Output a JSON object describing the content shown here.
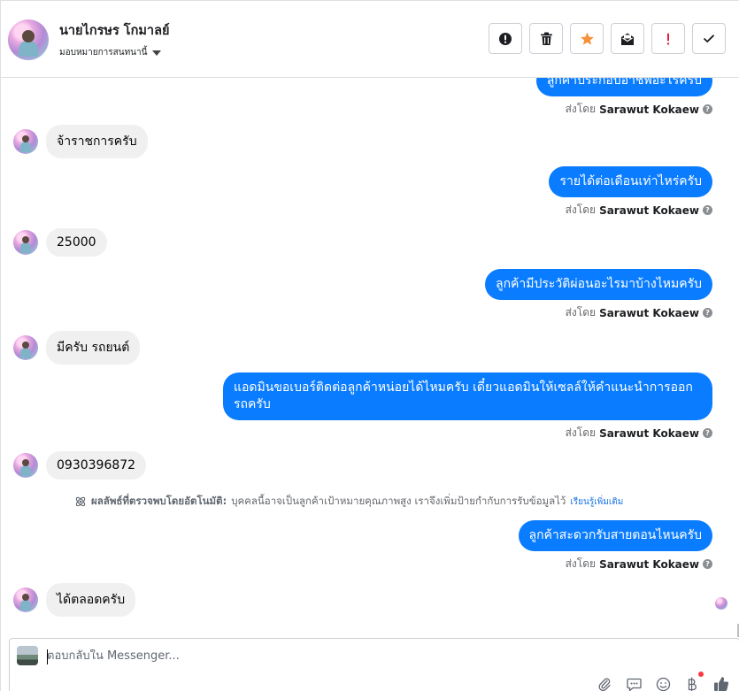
{
  "header": {
    "contact_name": "นายไกรษร โกมาลย์",
    "assign_label": "มอบหมายการสนทนานี้"
  },
  "toolbar": [
    {
      "name": "spam-button",
      "icon": "alert-circle-icon",
      "color": "#1c1e21"
    },
    {
      "name": "delete-button",
      "icon": "trash-icon",
      "color": "#1c1e21"
    },
    {
      "name": "star-button",
      "icon": "star-icon",
      "color": "#f7923b"
    },
    {
      "name": "mark-unread-button",
      "icon": "envelope-icon",
      "color": "#1c1e21"
    },
    {
      "name": "follow-up-button",
      "icon": "exclamation-icon",
      "color": "#e41e3f"
    },
    {
      "name": "done-button",
      "icon": "check-icon",
      "color": "#1c1e21"
    }
  ],
  "messages": [
    {
      "dir": "out",
      "text": "ลูกค้าประกอบอาชีพอะไรครับ",
      "sent_by_prefix": "ส่งโดย",
      "sent_by": "Sarawut Kokaew"
    },
    {
      "dir": "in",
      "text": "จ้าราชการครับ"
    },
    {
      "dir": "out",
      "text": "รายได้ต่อเดือนเท่าไหร่ครับ",
      "sent_by_prefix": "ส่งโดย",
      "sent_by": "Sarawut Kokaew"
    },
    {
      "dir": "in",
      "text": "25000"
    },
    {
      "dir": "out",
      "text": "ลูกค้ามีประวัติผ่อนอะไรมาบ้างไหมครับ",
      "sent_by_prefix": "ส่งโดย",
      "sent_by": "Sarawut Kokaew"
    },
    {
      "dir": "in",
      "text": "มีครับ รถยนต์"
    },
    {
      "dir": "out",
      "text": "แอดมินขอเบอร์ติดต่อลูกค้าหน่อยได้ไหมครับ เดี๋ยวแอดมินให้เซลล์ให้คำแนะนำการออกรถครับ",
      "sent_by_prefix": "ส่งโดย",
      "sent_by": "Sarawut Kokaew"
    },
    {
      "dir": "in",
      "text": "0930396872"
    },
    {
      "dir": "out",
      "text": "ลูกค้าสะดวกรับสายตอนไหนครับ",
      "sent_by_prefix": "ส่งโดย",
      "sent_by": "Sarawut Kokaew"
    },
    {
      "dir": "in",
      "text": "ได้ตลอดครับ"
    }
  ],
  "auto_note": {
    "bold": "ผลลัพธ์ที่ตรวจพบโดยอัตโนมัติ:",
    "text": "บุคคลนี้อาจเป็นลูกค้าเป้าหมายคุณภาพสูง เราจึงเพิ่มป้ายกำกับการรับข้อมูลไว้",
    "link": "เรียนรู้เพิ่มเติม"
  },
  "composer": {
    "placeholder": "ตอบกลับใน Messenger...",
    "tools": [
      "attach-icon",
      "saved-reply-icon",
      "emoji-icon",
      "baht-icon",
      "like-icon"
    ]
  },
  "colors": {
    "outgoing_bubble": "#0a7cff",
    "incoming_bubble": "#f0f0f0",
    "link": "#1b74e4"
  }
}
